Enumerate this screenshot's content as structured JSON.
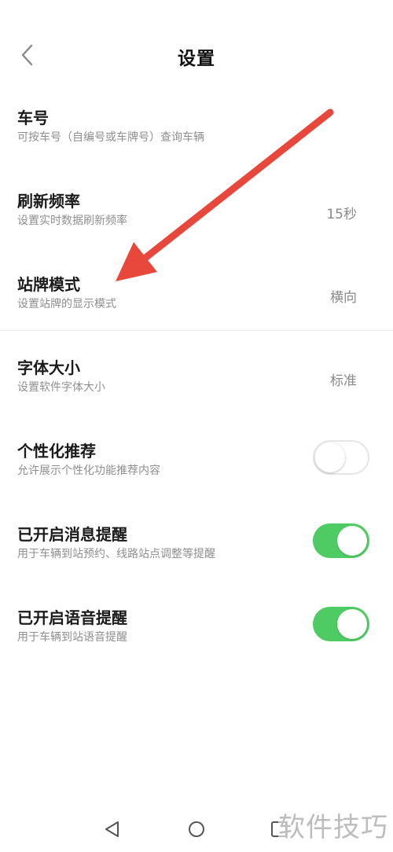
{
  "header": {
    "title": "设置"
  },
  "settings": [
    {
      "title": "车号",
      "subtitle": "可按车号（自编号或车牌号）查询车辆"
    },
    {
      "title": "刷新频率",
      "subtitle": "设置实时数据刷新频率",
      "value": "15秒"
    },
    {
      "title": "站牌模式",
      "subtitle": "设置站牌的显示模式",
      "value": "横向"
    },
    {
      "title": "字体大小",
      "subtitle": "设置软件字体大小",
      "value": "标准"
    },
    {
      "title": "个性化推荐",
      "subtitle": "允许展示个性化功能推荐内容",
      "toggle": false
    },
    {
      "title": "已开启消息提醒",
      "subtitle": "用于车辆到站预约、线路站点调整等提醒",
      "toggle": true
    },
    {
      "title": "已开启语音提醒",
      "subtitle": "用于车辆到站语音提醒",
      "toggle": true
    }
  ],
  "annotation": {
    "arrow_color": "#e8473c"
  },
  "colors": {
    "toggle_on": "#4ecb62",
    "toggle_off_border": "#e6e6e6"
  },
  "navbar": {
    "buttons": [
      "back-triangle-icon",
      "home-circle-icon",
      "recents-square-icon"
    ]
  },
  "watermark": {
    "text": "软件技巧"
  }
}
